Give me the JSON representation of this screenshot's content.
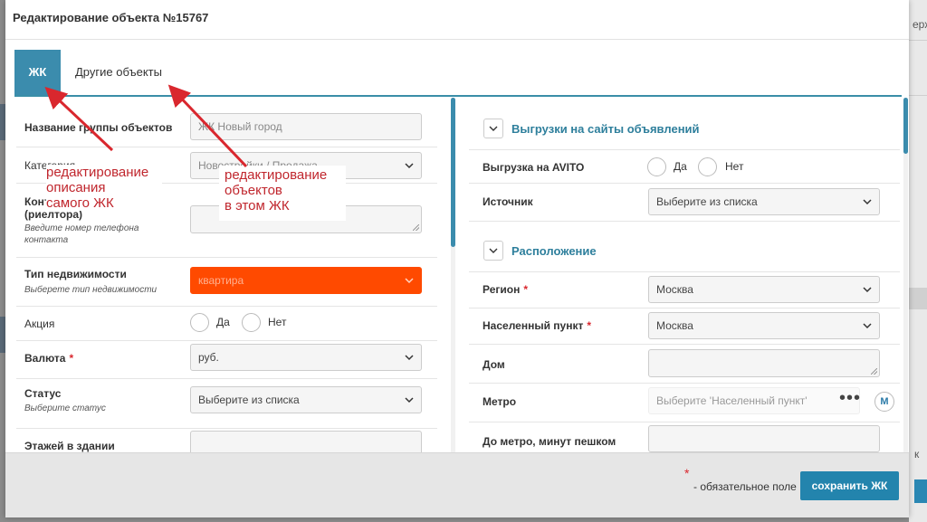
{
  "background": {
    "fragment_text": "ерж"
  },
  "modal": {
    "title": "Редактирование объекта №15767"
  },
  "tabs": [
    {
      "label": "ЖК",
      "active": true
    },
    {
      "label": "Другие объекты",
      "active": false
    }
  ],
  "left": {
    "group_name": {
      "label": "Название группы объектов",
      "value": "ЖК Новый город"
    },
    "category": {
      "label": "Категория",
      "value": "Новостройки / Продажа"
    },
    "contact_phone": {
      "label": "Контактный телефон (риелтора)",
      "hint": "Введите номер телефона контакта",
      "value": ""
    },
    "property_type": {
      "label": "Тип недвижимости",
      "hint": "Выберете тип недвижимости",
      "value": "квартира",
      "color": "#ff4a00"
    },
    "promo": {
      "label": "Акция",
      "yes": "Да",
      "no": "Нет"
    },
    "currency": {
      "label": "Валюта",
      "value": "руб."
    },
    "status": {
      "label": "Статус",
      "hint": "Выберите статус",
      "value": "Выберите из списка"
    },
    "floors": {
      "label": "Этажей в здании",
      "value": ""
    }
  },
  "right": {
    "exports_section": "Выгрузки на сайты объявлений",
    "avito": {
      "label": "Выгрузка на AVITO",
      "yes": "Да",
      "no": "Нет"
    },
    "source": {
      "label": "Источник",
      "value": "Выберите из списка"
    },
    "location_section": "Расположение",
    "region": {
      "label": "Регион",
      "value": "Москва"
    },
    "locality": {
      "label": "Населенный пункт",
      "value": "Москва"
    },
    "house": {
      "label": "Дом",
      "value": ""
    },
    "metro": {
      "label": "Метро",
      "placeholder": "Выберите 'Населенный пункт'",
      "icon_letter": "М"
    },
    "walk": {
      "label": "До метро, минут пешком",
      "value": ""
    }
  },
  "footer": {
    "required_star": "*",
    "required_note": "- обязательное поле",
    "save_label": "сохранить ЖК"
  },
  "annotations": {
    "group": [
      "редактирование",
      "описания",
      "самого ЖК"
    ],
    "objects": [
      "редактирование",
      "объектов",
      "в этом ЖК"
    ]
  },
  "colors": {
    "accent": "#3b8cad",
    "annotation": "#c0262d",
    "required": "#d9272e"
  }
}
